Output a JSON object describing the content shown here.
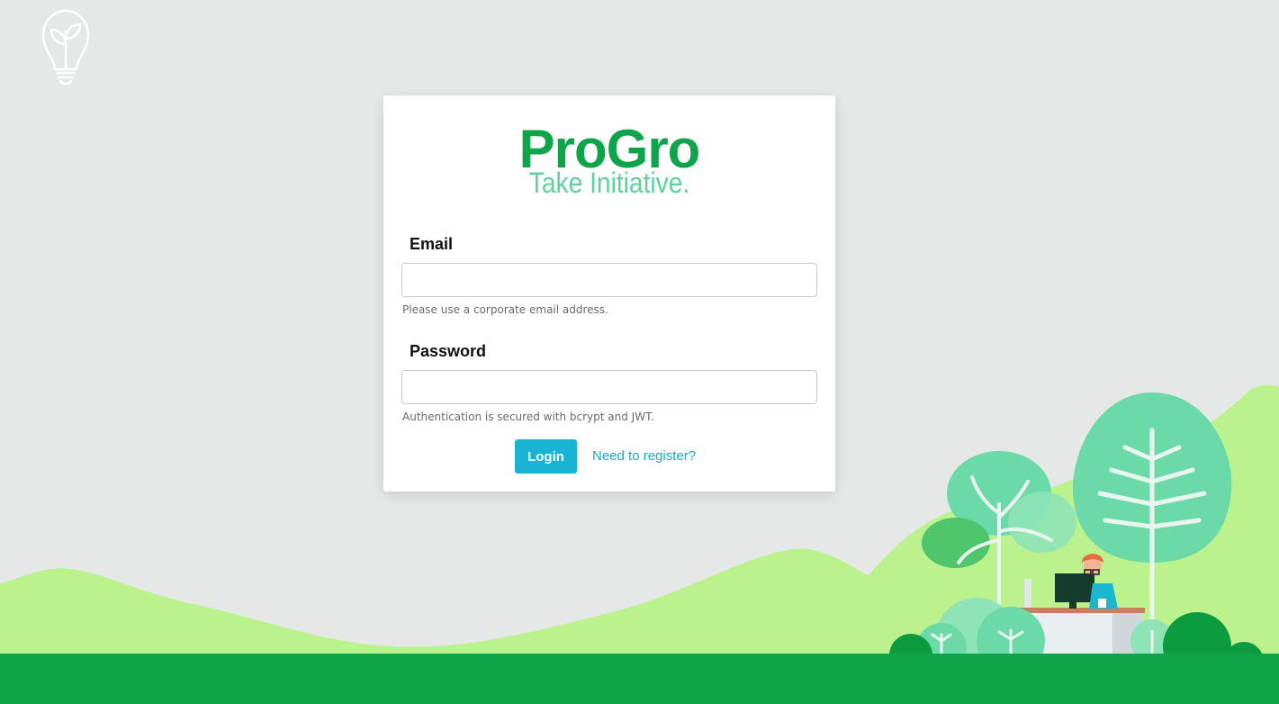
{
  "brand": {
    "name": "ProGro",
    "tagline": "Take Initiative."
  },
  "login_form": {
    "email_label": "Email",
    "email_value": "",
    "email_help": "Please use a corporate email address.",
    "password_label": "Password",
    "password_value": "",
    "password_help": "Authentication is secured with bcrypt and JWT.",
    "login_label": "Login",
    "register_link": "Need to register?"
  },
  "icons": {
    "logo": "lightbulb-sprout-icon"
  },
  "colors": {
    "background": "#e5e8e7",
    "brand_green": "#0da44a",
    "tagline_green": "#5fd19a",
    "accent_blue": "#19b4d4",
    "hill_green": "#bcf28e",
    "ground_green": "#0da44a"
  }
}
